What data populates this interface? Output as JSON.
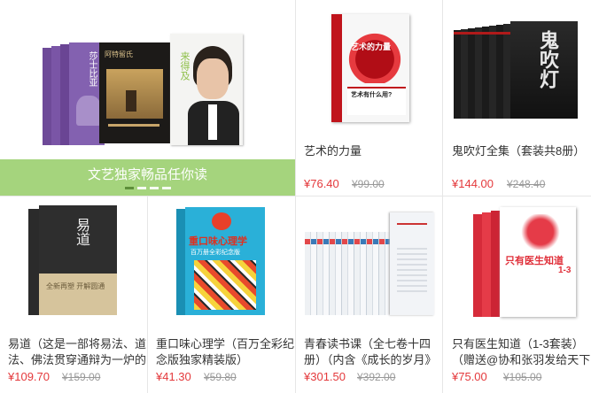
{
  "banner": {
    "caption": "文艺独家畅品任你读",
    "book_text_1": "莎士比亚",
    "book_text_2": "阿特留氏",
    "book_text_3": "来得及"
  },
  "products": [
    {
      "title": "艺术的力量",
      "price": "¥76.40",
      "old_price": "¥99.00",
      "cover_text": "艺术的力量",
      "cover_sub": "艺术有什么用?"
    },
    {
      "title": "鬼吹灯全集（套装共8册）",
      "price": "¥144.00",
      "old_price": "¥248.40",
      "cover_text": "鬼吹灯"
    },
    {
      "title_line1": "易道（这是一部将易法、道",
      "title_line2": "法、佛法贯穿通辩为一炉的",
      "price": "¥109.70",
      "old_price": "¥159.00",
      "cover_text": "易道",
      "cover_sub": "全新再塑 开解圆通"
    },
    {
      "title_line1": "重口味心理学（百万全彩纪",
      "title_line2": "念版独家精装版）",
      "price": "¥41.30",
      "old_price": "¥59.80",
      "cover_text": "重口味心理学",
      "cover_sub": "百万册全彩纪念版"
    },
    {
      "title_line1": "青春读书课（全七卷十四",
      "title_line2": "册）（内含《成长的岁月》",
      "price": "¥301.50",
      "old_price": "¥392.00"
    },
    {
      "title_line1": "只有医生知道（1-3套装）",
      "title_line2": "（赠送@协和张羽发给天下",
      "price": "¥75.00",
      "old_price": "¥105.00",
      "cover_text": "只有医生知道",
      "cover_num": "1-3"
    }
  ]
}
